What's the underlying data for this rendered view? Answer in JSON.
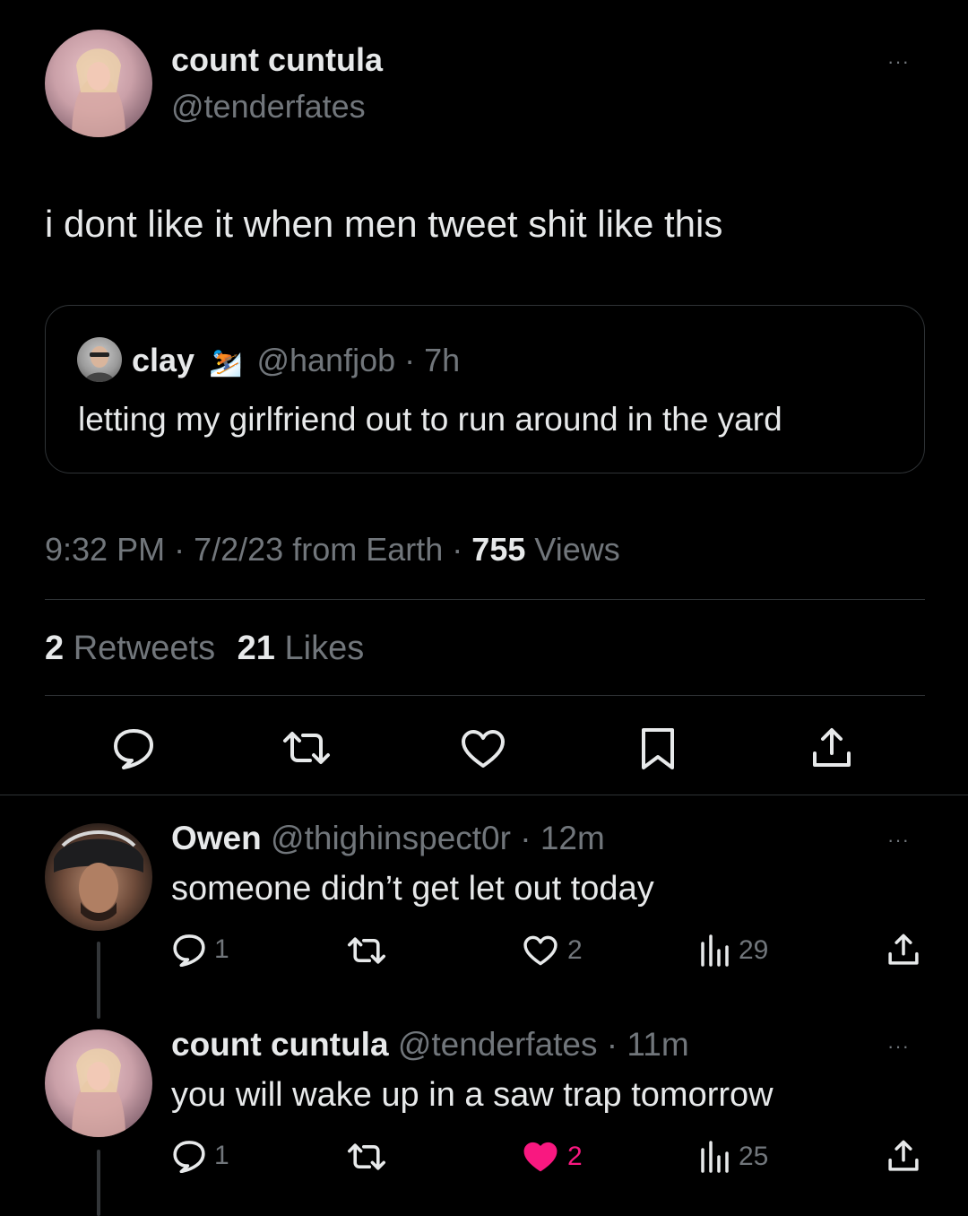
{
  "tweet": {
    "author": {
      "name": "count cuntula",
      "handle": "@tenderfates"
    },
    "text": "i dont like it when men tweet shit like this",
    "quote": {
      "name": "clay",
      "name_emoji": "⛷️",
      "handle": "@hanfjob",
      "sep": "·",
      "time": "7h",
      "text": "letting my girlfriend out to run around in the yard"
    },
    "meta": {
      "time": "9:32 PM",
      "date": "7/2/23",
      "source": "from Earth",
      "sep": "·",
      "views_count": "755",
      "views_label": "Views"
    },
    "stats": {
      "retweets_count": "2",
      "retweets_label": "Retweets",
      "likes_count": "21",
      "likes_label": "Likes"
    },
    "more_label": "···"
  },
  "replies": [
    {
      "name": "Owen",
      "handle": "@thighinspect0r",
      "sep": "·",
      "time": "12m",
      "text": "someone didn’t get let out today",
      "reply_count": "1",
      "like_count": "2",
      "views_count": "29",
      "liked": false
    },
    {
      "name": "count cuntula",
      "handle": "@tenderfates",
      "sep": "·",
      "time": "11m",
      "text": "you will wake up in a saw trap tomorrow",
      "reply_count": "1",
      "like_count": "2",
      "views_count": "25",
      "liked": true
    }
  ],
  "colors": {
    "background": "#000000",
    "text": "#e7e9ea",
    "muted": "#71767b",
    "divider": "#2f3336",
    "like_active": "#f91880"
  },
  "icons": [
    "reply-icon",
    "retweet-icon",
    "like-icon",
    "bookmark-icon",
    "share-icon",
    "views-icon",
    "more-icon"
  ]
}
